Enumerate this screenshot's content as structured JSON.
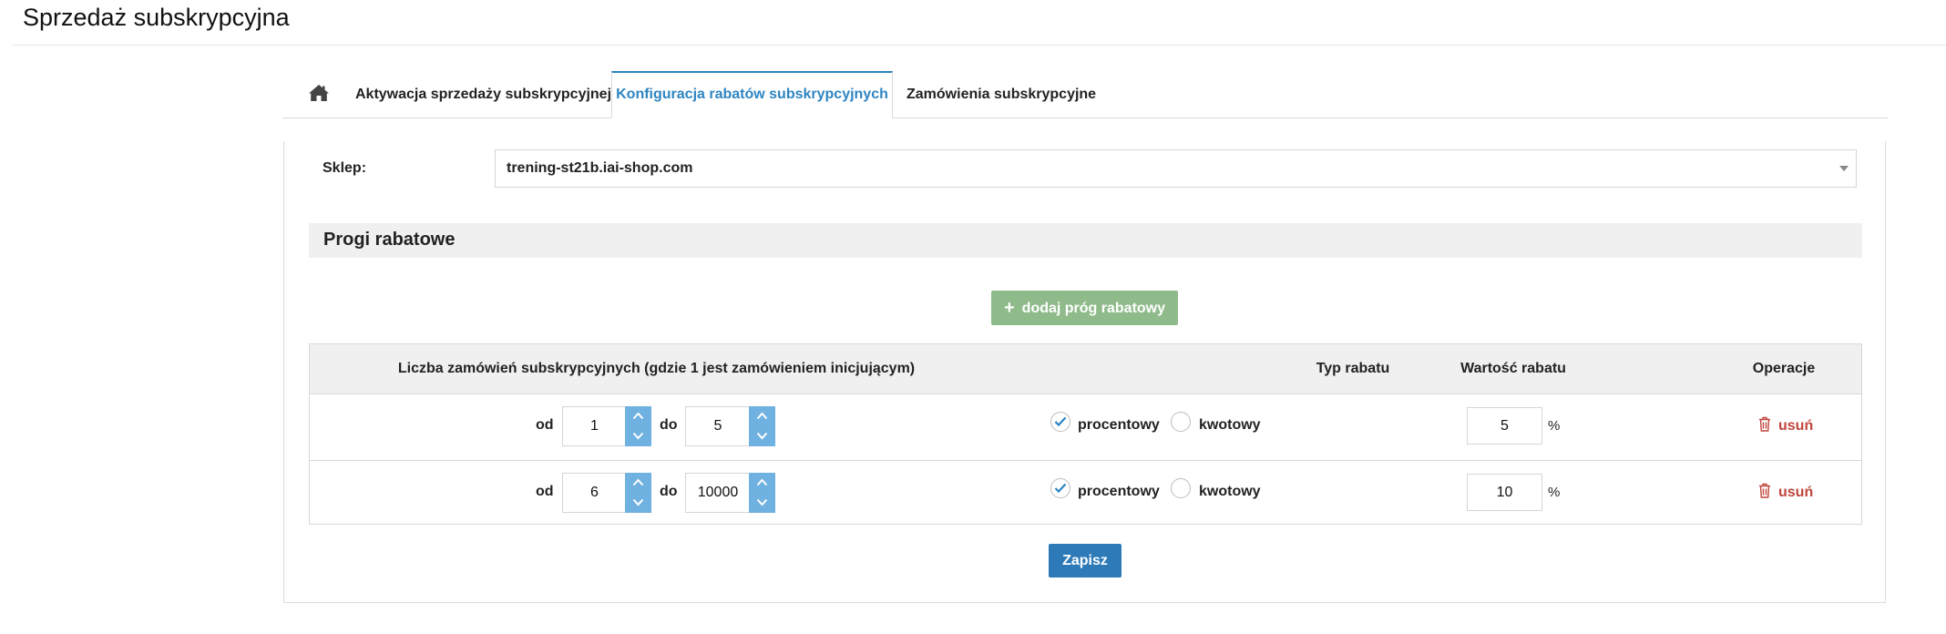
{
  "page": {
    "title": "Sprzedaż subskrypcyjna"
  },
  "tabs": [
    {
      "label": "",
      "icon": "home-icon"
    },
    {
      "label": "Aktywacja sprzedaży subskrypcyjnej"
    },
    {
      "label": "Konfiguracja rabatów subskrypcyjnych",
      "active": true
    },
    {
      "label": "Zamówienia subskrypcyjne"
    }
  ],
  "shop": {
    "label": "Sklep:",
    "selected": "trening-st21b.iai-shop.com"
  },
  "thresholds_section": {
    "title": "Progi rabatowe",
    "add_button": "dodaj próg rabatowy",
    "columns": [
      "Liczba zamówień subskrypcyjnych (gdzie 1 jest zamówieniem inicjującym)",
      "Typ rabatu",
      "Wartość rabatu",
      "Operacje"
    ],
    "rows": [
      {
        "from_label": "od",
        "from": "1",
        "to_label": "do",
        "to": "5",
        "type_percent": "procentowy",
        "type_amount": "kwotowy",
        "selected_type": "procentowy",
        "value": "5",
        "unit": "%",
        "delete": "usuń"
      },
      {
        "from_label": "od",
        "from": "6",
        "to_label": "do",
        "to": "10000",
        "type_percent": "procentowy",
        "type_amount": "kwotowy",
        "selected_type": "procentowy",
        "value": "10",
        "unit": "%",
        "delete": "usuń"
      }
    ]
  },
  "save_button": "Zapisz",
  "colors": {
    "accent_blue": "#2e85c2",
    "spinner_blue": "#6fb1e0",
    "add_green": "#8fbb8b",
    "save_blue": "#2e7ab8",
    "delete_red": "#c0453b"
  }
}
